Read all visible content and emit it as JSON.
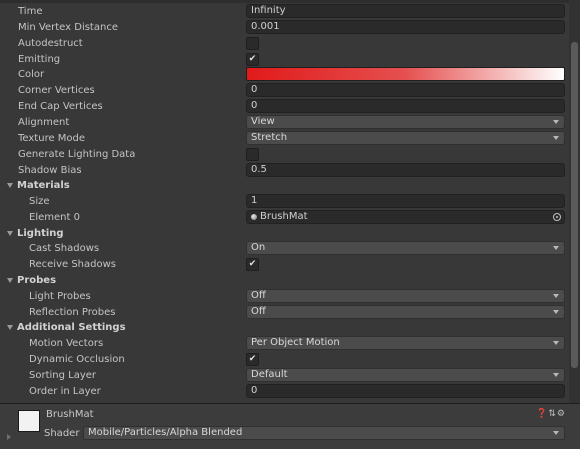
{
  "properties": [
    {
      "label": "Time",
      "kind": "field",
      "value": "Infinity"
    },
    {
      "label": "Min Vertex Distance",
      "kind": "field",
      "value": "0.001"
    },
    {
      "label": "Autodestruct",
      "kind": "check",
      "checked": false
    },
    {
      "label": "Emitting",
      "kind": "check",
      "checked": true
    },
    {
      "label": "Color",
      "kind": "color"
    },
    {
      "label": "Corner Vertices",
      "kind": "field",
      "value": "0"
    },
    {
      "label": "End Cap Vertices",
      "kind": "field",
      "value": "0"
    },
    {
      "label": "Alignment",
      "kind": "dropdown",
      "value": "View"
    },
    {
      "label": "Texture Mode",
      "kind": "dropdown",
      "value": "Stretch"
    },
    {
      "label": "Generate Lighting Data",
      "kind": "check",
      "checked": false
    },
    {
      "label": "Shadow Bias",
      "kind": "field",
      "value": "0.5"
    }
  ],
  "sections": {
    "materials": {
      "title": "Materials",
      "size_label": "Size",
      "size_value": "1",
      "element_label": "Element 0",
      "element_value": "BrushMat"
    },
    "lighting": {
      "title": "Lighting",
      "cast_shadows_label": "Cast Shadows",
      "cast_shadows_value": "On",
      "receive_shadows_label": "Receive Shadows",
      "receive_shadows_checked": true
    },
    "probes": {
      "title": "Probes",
      "light_probes_label": "Light Probes",
      "light_probes_value": "Off",
      "reflection_probes_label": "Reflection Probes",
      "reflection_probes_value": "Off"
    },
    "additional": {
      "title": "Additional Settings",
      "motion_vectors_label": "Motion Vectors",
      "motion_vectors_value": "Per Object Motion",
      "dynamic_occlusion_label": "Dynamic Occlusion",
      "dynamic_occlusion_checked": true,
      "sorting_layer_label": "Sorting Layer",
      "sorting_layer_value": "Default",
      "order_in_layer_label": "Order in Layer",
      "order_in_layer_value": "0"
    }
  },
  "material_panel": {
    "name": "BrushMat",
    "shader_label": "Shader",
    "shader_value": "Mobile/Particles/Alpha Blended",
    "header_icons": [
      "help-icon",
      "preset-icon",
      "settings-icon"
    ]
  },
  "colors": {
    "background": "#383838",
    "color_gradient_start": "#e11a1a",
    "color_gradient_end": "#ffffff"
  }
}
